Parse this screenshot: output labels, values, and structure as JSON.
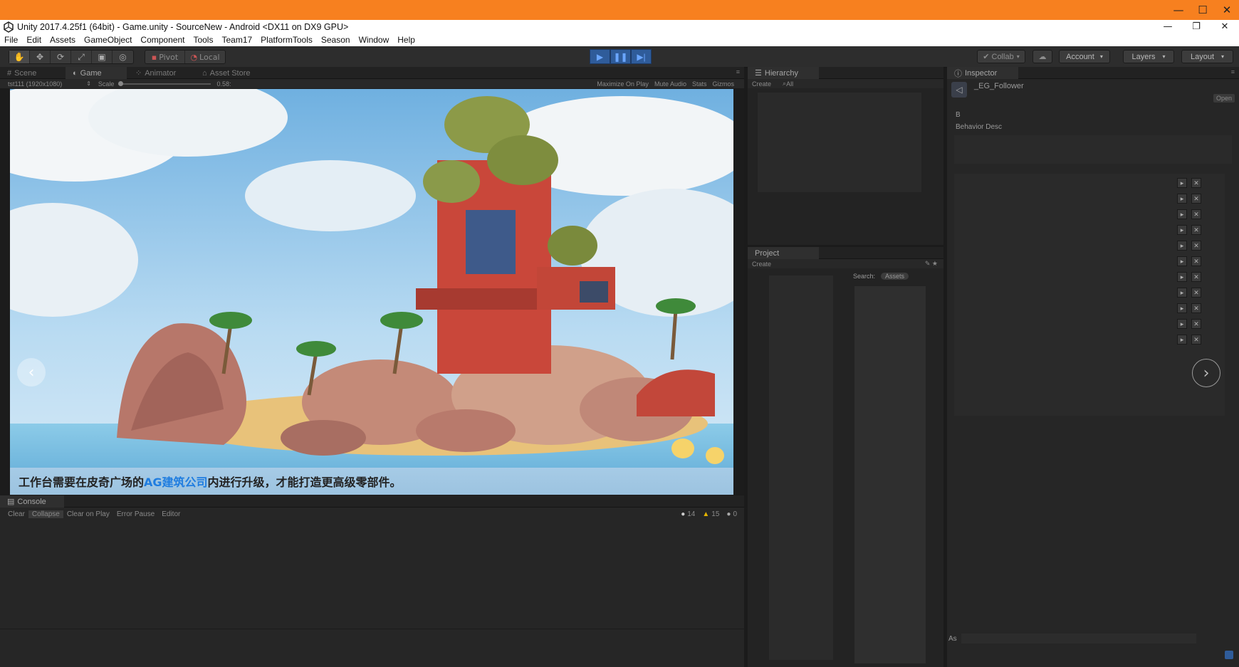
{
  "window": {
    "title": "Unity 2017.4.25f1 (64bit) - Game.unity - SourceNew - Android <DX11 on DX9 GPU>",
    "os_buttons": [
      "—",
      "☐",
      "✕"
    ]
  },
  "menu": [
    "File",
    "Edit",
    "Assets",
    "GameObject",
    "Component",
    "Tools",
    "Team17",
    "PlatformTools",
    "Season",
    "Window",
    "Help"
  ],
  "toolbar": {
    "pivot": "Pivot",
    "local": "Local",
    "collab": "Collab",
    "account": "Account",
    "layers": "Layers",
    "layout": "Layout"
  },
  "scene_tabs": {
    "scene": "Scene",
    "game": "Game",
    "animator": "Animator",
    "asset_store": "Asset Store"
  },
  "game_bar": {
    "resolution": "tst111 (1920x1080)",
    "scale_label": "Scale",
    "scale_value": "0.58:",
    "maximize": "Maximize On Play",
    "mute": "Mute Audio",
    "stats": "Stats",
    "gizmos": "Gizmos"
  },
  "game_view": {
    "caption_before": "工作台需要在皮奇广场的",
    "caption_highlight": "AG建筑公司",
    "caption_after": "内进行升级，才能打造更高级零部件。"
  },
  "hierarchy": {
    "tab": "Hierarchy",
    "create": "Create",
    "search": "All"
  },
  "project": {
    "tab": "Project",
    "create": "Create",
    "search_label": "Search:",
    "assets_chip": "Assets"
  },
  "inspector": {
    "tab": "Inspector",
    "object_name": "_EG_Follower",
    "open": "Open",
    "field_b": "B",
    "behavior_desc": "Behavior Desc",
    "asset_label": "As"
  },
  "console": {
    "tab": "Console",
    "clear": "Clear",
    "collapse": "Collapse",
    "clear_on_play": "Clear on Play",
    "error_pause": "Error Pause",
    "editor": "Editor",
    "info_count": "14",
    "warn_count": "15",
    "error_count": "0"
  }
}
